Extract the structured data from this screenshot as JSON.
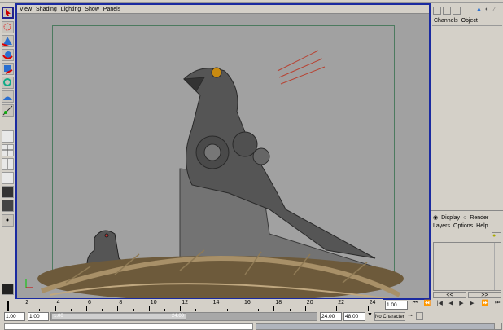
{
  "viewport": {
    "menu": [
      "View",
      "Shading",
      "Lighting",
      "Show",
      "Panels"
    ]
  },
  "channel_box": {
    "tabs": [
      "Channels",
      "Object"
    ]
  },
  "layer_editor": {
    "display_label": "Display",
    "render_label": "Render",
    "menu": [
      "Layers",
      "Options",
      "Help"
    ],
    "scroll_left": "<<",
    "scroll_right": ">>"
  },
  "timeline": {
    "ticks": [
      "2",
      "4",
      "6",
      "8",
      "10",
      "12",
      "14",
      "16",
      "18",
      "20",
      "22",
      "24"
    ],
    "current_time": "1.00"
  },
  "range": {
    "start_time": "1.00",
    "playback_start": "1.00",
    "slider_start": "1.00",
    "slider_end": "24.00",
    "playback_end": "24.00",
    "end_time": "48.00"
  },
  "character_set": "No Character Set",
  "colors": {
    "viewport": "#a1a1a1",
    "border": "#1a2aa0",
    "panel": "#d4d0c8"
  }
}
